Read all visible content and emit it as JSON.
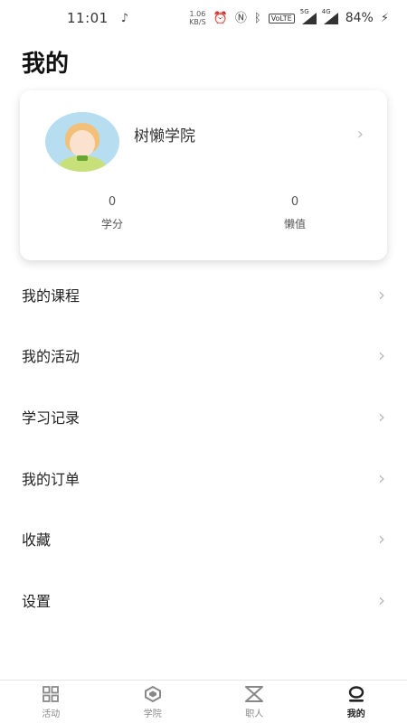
{
  "status_bar": {
    "time": "11:01",
    "net_speed_value": "1.06",
    "net_speed_unit": "KB/S",
    "volte": "VoLTE",
    "signal1": "5G",
    "signal2": "4G",
    "battery": "84%"
  },
  "page": {
    "title": "我的"
  },
  "profile": {
    "name": "树懒学院",
    "stats": [
      {
        "value": "0",
        "label": "学分"
      },
      {
        "value": "0",
        "label": "懒值"
      }
    ]
  },
  "menu": [
    {
      "label": "我的课程"
    },
    {
      "label": "我的活动"
    },
    {
      "label": "学习记录"
    },
    {
      "label": "我的订单"
    },
    {
      "label": "收藏"
    },
    {
      "label": "设置"
    }
  ],
  "bottom_nav": [
    {
      "label": "活动",
      "icon": "grid-icon"
    },
    {
      "label": "学院",
      "icon": "hexagon-icon"
    },
    {
      "label": "职人",
      "icon": "hourglass-icon"
    },
    {
      "label": "我的",
      "icon": "user-ring-icon",
      "active": true
    }
  ],
  "colors": {
    "accent": "#222222",
    "inactive": "#888888"
  }
}
